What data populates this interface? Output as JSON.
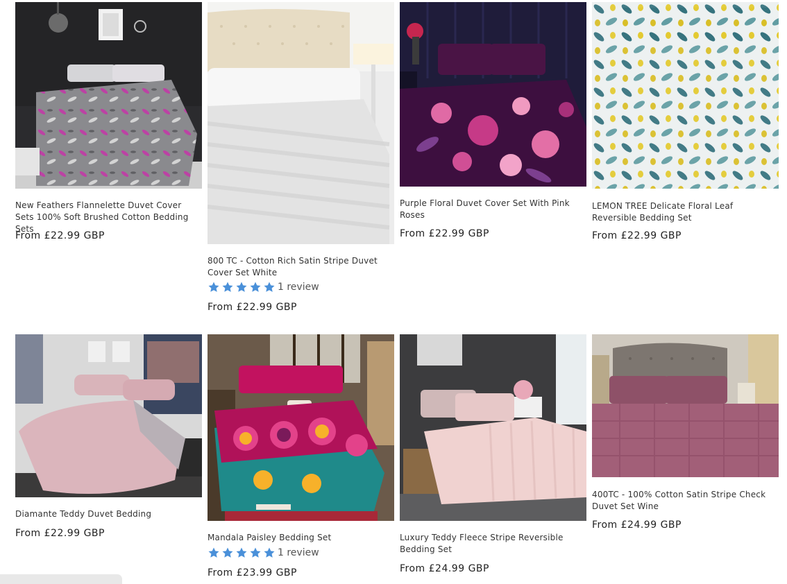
{
  "products": [
    {
      "title": "New Feathers Flannelette Duvet Cover Sets 100% Soft Brushed Cotton Bedding Sets",
      "price": "From £22.99 GBP",
      "image": "grey-pink-feather-duvet-photo"
    },
    {
      "title": "800 TC - Cotton Rich Satin Stripe Duvet Cover Set White",
      "price": "From £22.99 GBP",
      "rating": 5,
      "reviews": "1 review",
      "image": "white-satin-stripe-duvet-photo"
    },
    {
      "title": "Purple Floral Duvet Cover Set With Pink Roses",
      "price": "From £22.99 GBP",
      "image": "purple-floral-duvet-photo"
    },
    {
      "title": "LEMON TREE Delicate Floral Leaf Reversible Bedding Set",
      "price": "From £22.99 GBP",
      "image": "lemon-tree-leaf-duvet-photo"
    },
    {
      "title": "Diamante Teddy Duvet Bedding",
      "price": "From £22.99 GBP",
      "image": "pink-teddy-duvet-photo"
    },
    {
      "title": "Mandala Paisley Bedding Set",
      "price": "From £23.99 GBP",
      "rating": 5,
      "reviews": "1 review",
      "image": "mandala-paisley-bedding-photo"
    },
    {
      "title": "Luxury Teddy Fleece Stripe Reversible Bedding Set",
      "price": "From £24.99 GBP",
      "image": "blush-teddy-fleece-bedding-photo"
    },
    {
      "title": "400TC - 100% Cotton Satin Stripe Check Duvet Set Wine",
      "price": "From £24.99 GBP",
      "image": "wine-satin-check-duvet-photo"
    }
  ],
  "colors": {
    "star": "#4a90d9",
    "text": "#222222"
  }
}
